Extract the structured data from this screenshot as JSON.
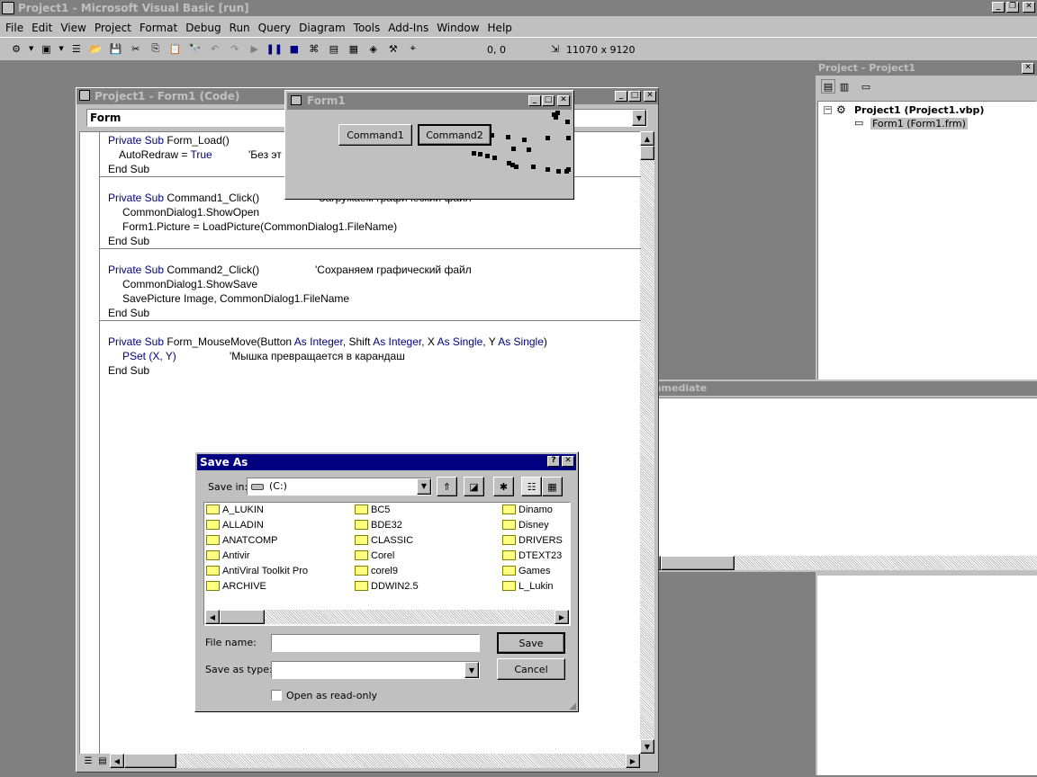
{
  "app": {
    "title": "Project1 - Microsoft Visual Basic [run]"
  },
  "menu": [
    "File",
    "Edit",
    "View",
    "Project",
    "Format",
    "Debug",
    "Run",
    "Query",
    "Diagram",
    "Tools",
    "Add-Ins",
    "Window",
    "Help"
  ],
  "toolbar": {
    "position": "0, 0",
    "size": "11070 x 9120"
  },
  "code_window": {
    "title": "Project1 - Form1 (Code)",
    "object_combo": "Form",
    "lines": [
      {
        "kw": "Private Sub ",
        "text": "Form_Load()",
        "comment": ""
      },
      {
        "kw": "",
        "text": "AutoRedraw = ",
        "kw2": "True",
        "comment": "'Без эт"
      },
      {
        "kw": "End Sub",
        "text": "",
        "comment": ""
      },
      {
        "kw": "Private Sub ",
        "text": "Command1_Click()",
        "comment": "'Загружаем графический файл"
      },
      {
        "kw": "",
        "text": "CommonDialog1.ShowOpen",
        "comment": ""
      },
      {
        "kw": "",
        "text": "Form1.Picture = LoadPicture(CommonDialog1.FileName)",
        "comment": ""
      },
      {
        "kw": "End Sub",
        "text": "",
        "comment": ""
      },
      {
        "kw": "Private Sub ",
        "text": "Command2_Click()",
        "comment": "'Сохраняем графический файл"
      },
      {
        "kw": "",
        "text": "CommonDialog1.ShowSave",
        "comment": ""
      },
      {
        "kw": "",
        "text": "SavePicture Image, CommonDialog1.FileName",
        "comment": ""
      },
      {
        "kw": "End Sub",
        "text": "",
        "comment": ""
      },
      {
        "kw": "Private Sub ",
        "text": "Form_MouseMove(Button ",
        "comment": ""
      },
      {
        "kw": "",
        "text": "PSet (X, Y)",
        "comment": "'Мышка превращается в карандаш"
      },
      {
        "kw": "End Sub",
        "text": "",
        "comment": ""
      }
    ],
    "mousemove_parts": [
      "Private Sub ",
      "Form_MouseMove(Button ",
      "As Integer",
      ", Shift ",
      "As Integer",
      ", X ",
      "As Single",
      ", Y ",
      "As Single",
      ")"
    ],
    "autoredraw_parts": [
      "AutoRedraw = ",
      "True"
    ]
  },
  "form1": {
    "title": "Form1",
    "command1": "Command1",
    "command2": "Command2"
  },
  "project": {
    "title": "Project - Project1",
    "root": "Project1 (Project1.vbp)",
    "child": "Form1 (Form1.frm)"
  },
  "immediate": {
    "title": "Immediate"
  },
  "save_dialog": {
    "title": "Save As",
    "save_in_label": "Save in:",
    "save_in_value": "(C:)",
    "files_col1": [
      "A_LUKIN",
      "ALLADIN",
      "ANATCOMP",
      "Antivir",
      "AntiViral Toolkit Pro",
      "ARCHIVE"
    ],
    "files_col2": [
      "BC5",
      "BDE32",
      "CLASSIC",
      "Corel",
      "corel9",
      "DDWIN2.5"
    ],
    "files_col3": [
      "Dinamo",
      "Disney",
      "DRIVERS",
      "DTEXT23",
      "Games",
      "L_Lukin"
    ],
    "file_name_label": "File name:",
    "file_name_value": "",
    "save_type_label": "Save as type:",
    "save_type_value": "",
    "save_button": "Save",
    "cancel_button": "Cancel",
    "readonly_label": "Open as read-only"
  }
}
